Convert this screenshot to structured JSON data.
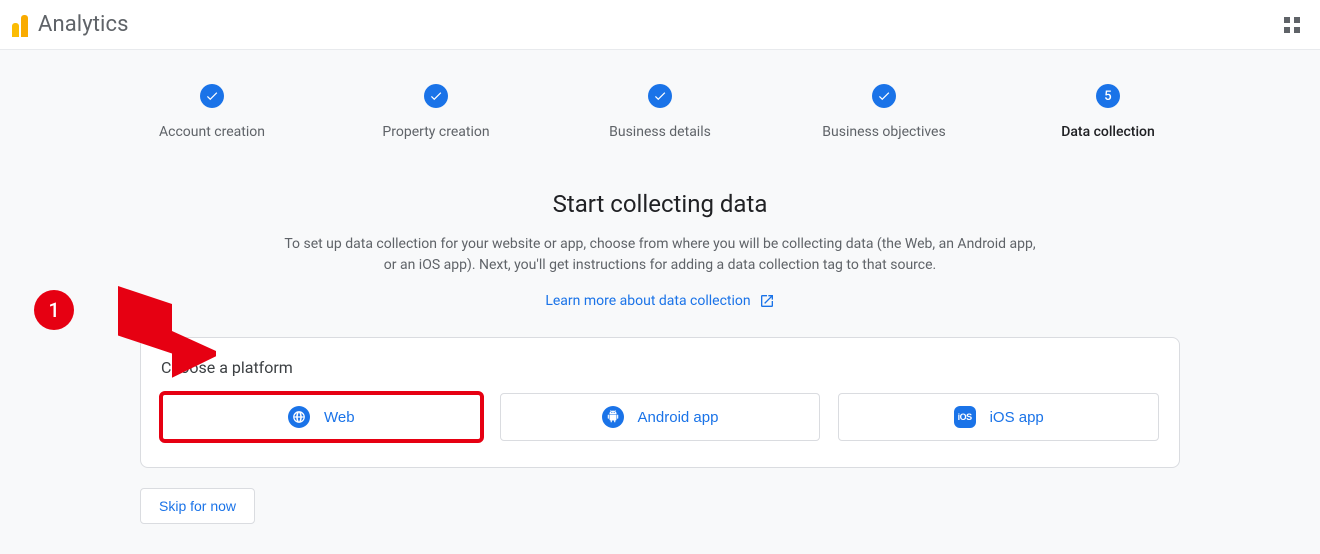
{
  "header": {
    "app_title": "Analytics"
  },
  "stepper": {
    "steps": [
      {
        "label": "Account creation",
        "completed": true
      },
      {
        "label": "Property creation",
        "completed": true
      },
      {
        "label": "Business details",
        "completed": true
      },
      {
        "label": "Business objectives",
        "completed": true
      },
      {
        "label": "Data collection",
        "number": "5",
        "active": true
      }
    ]
  },
  "main": {
    "title": "Start collecting data",
    "description": "To set up data collection for your website or app, choose from where you will be collecting data (the Web, an Android app, or an iOS app). Next, you'll get instructions for adding a data collection tag to that source.",
    "learn_link": "Learn more about data collection"
  },
  "platform": {
    "title": "Choose a platform",
    "options": {
      "web": "Web",
      "android": "Android app",
      "ios": "iOS app"
    }
  },
  "skip_label": "Skip for now",
  "annotation": {
    "badge": "1"
  }
}
